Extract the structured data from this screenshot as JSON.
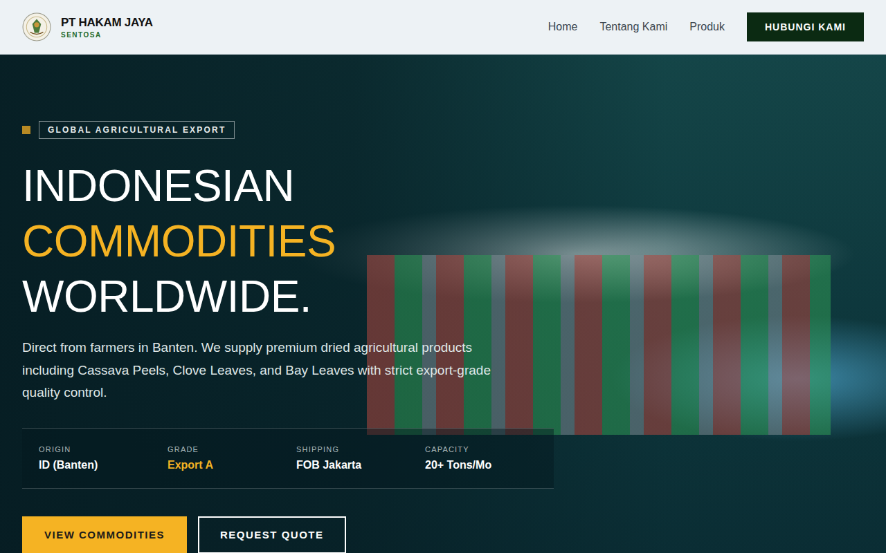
{
  "header": {
    "brand": {
      "name": "PT HAKAM JAYA",
      "sub": "SENTOSA"
    },
    "nav": [
      {
        "label": "Home"
      },
      {
        "label": "Tentang Kami"
      },
      {
        "label": "Produk"
      }
    ],
    "cta": "HUBUNGI KAMI"
  },
  "hero": {
    "badge": "GLOBAL AGRICULTURAL EXPORT",
    "headline": [
      {
        "text": "INDONESIAN",
        "highlight": false
      },
      {
        "text": "COMMODITIES",
        "highlight": true
      },
      {
        "text": "WORLDWIDE.",
        "highlight": false
      }
    ],
    "description": "Direct from farmers in Banten. We supply premium dried agricultural products including Cassava Peels, Clove Leaves, and Bay Leaves with strict export-grade quality control.",
    "stats": [
      {
        "label": "ORIGIN",
        "value": "ID (Banten)",
        "highlight": false
      },
      {
        "label": "GRADE",
        "value": "Export A",
        "highlight": true
      },
      {
        "label": "SHIPPING",
        "value": "FOB Jakarta",
        "highlight": false
      },
      {
        "label": "CAPACITY",
        "value": "20+ Tons/Mo",
        "highlight": false
      }
    ],
    "buttons": [
      {
        "label": "VIEW COMMODITIES",
        "kind": "primary"
      },
      {
        "label": "REQUEST QUOTE",
        "kind": "outline"
      }
    ]
  }
}
